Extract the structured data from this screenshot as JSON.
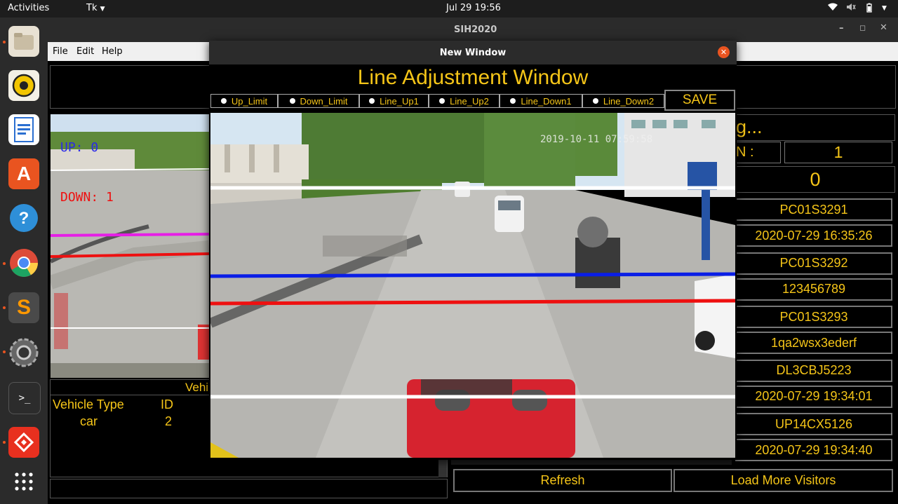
{
  "topbar": {
    "activities": "Activities",
    "app": "Tk",
    "clock": "Jul 29  19:56"
  },
  "window": {
    "title": "SIH2020"
  },
  "menu": {
    "file": "File",
    "edit": "Edit",
    "help": "Help"
  },
  "left_feed": {
    "up_label": "UP: 0",
    "down_label": "DOWN: 1"
  },
  "vehicle_table": {
    "header_partial": "Vehi",
    "col_type": "Vehicle Type",
    "col_id": "ID",
    "rows": [
      {
        "type": "car",
        "id": "2"
      }
    ]
  },
  "right_panel": {
    "title_partial": "g...",
    "label_partial": "N :",
    "count1": "1",
    "count2": "0",
    "visitors": [
      {
        "plate": "PC01S3291",
        "detail": "2020-07-29 16:35:26"
      },
      {
        "plate": "PC01S3292",
        "detail": "123456789"
      },
      {
        "plate": "PC01S3293",
        "detail": "1qa2wsx3ederf"
      },
      {
        "plate": "DL3CBJ5223",
        "detail": "2020-07-29 19:34:01"
      },
      {
        "plate": "UP14CX5126",
        "detail": "2020-07-29 19:34:40"
      }
    ],
    "refresh": "Refresh",
    "load_more": "Load More Visitors"
  },
  "popup": {
    "title": "New Window",
    "heading": "Line Adjustment Window",
    "options": [
      "Up_Limit",
      "Down_Limit",
      "Line_Up1",
      "Line_Up2",
      "Line_Down1",
      "Line_Down2"
    ],
    "save": "SAVE",
    "timestamp": "2019-10-11 07:59:58"
  },
  "colors": {
    "accent_yellow": "#f5c518",
    "line_white": "#ffffff",
    "line_blue": "#0a1ee6",
    "line_red": "#ee1010",
    "line_magenta": "#e61ee6",
    "close_orange": "#e95420"
  }
}
